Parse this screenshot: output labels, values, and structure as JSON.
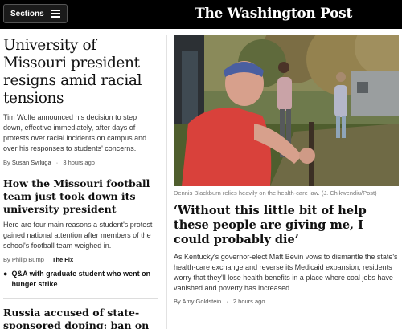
{
  "header": {
    "sections_label": "Sections",
    "masthead": "The Washington Post"
  },
  "lead_story": {
    "headline": "University of Missouri president resigns amid racial tensions",
    "blurb": "Tim Wolfe announced his decision to step down, effective immediately, after days of protests over racial incidents on campus and over his responses to students' concerns.",
    "byline_prefix": "By",
    "author": "Susan Svrluga",
    "timestamp": "3 hours ago"
  },
  "story2": {
    "headline": "How the Missouri football team just took down its university president",
    "blurb": "Here are four main reasons a student's protest gained national attention after members of the school's football team weighed in.",
    "byline_prefix": "By",
    "author": "Philip Bump",
    "section": "The Fix",
    "related": "Q&A with graduate student who went on hunger strike"
  },
  "story3": {
    "headline": "Russia accused of state-sponsored doping; ban on athletes urged"
  },
  "feature": {
    "caption": "Dennis Blackburn relies heavily on the health-care law. (J. Chikwendiu/Post)",
    "headline": "‘Without this little bit of help these people are giving me, I could probably die’",
    "blurb": "As Kentucky's governor-elect Matt Bevin vows to dismantle the state's health-care exchange and reverse its Medicaid expansion, residents worry that they'll lose health benefits in a place where coal jobs have vanished and poverty has increased.",
    "byline_prefix": "By",
    "author": "Amy Goldstein",
    "timestamp": "2 hours ago"
  }
}
